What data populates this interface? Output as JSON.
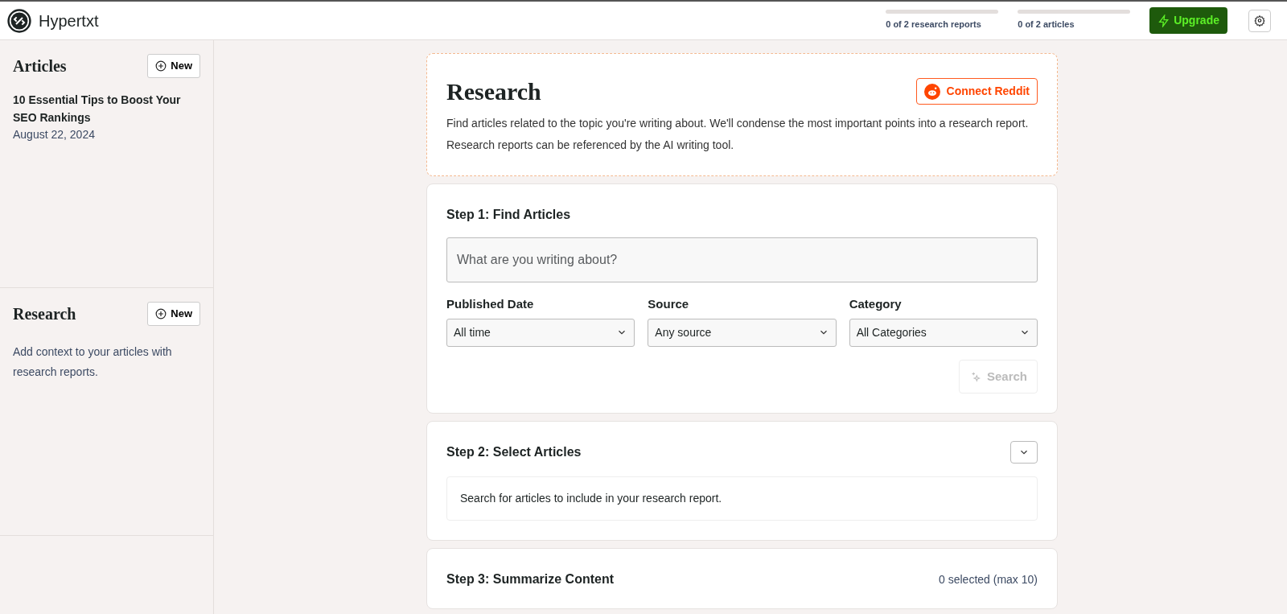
{
  "header": {
    "brand": "Hypertxt",
    "usage": [
      {
        "label": "0 of 2 research reports",
        "level": 0
      },
      {
        "label": "0 of 2 articles",
        "level": 0
      }
    ],
    "upgrade_button": "Upgrade"
  },
  "sidebar": {
    "sections": [
      {
        "title": "Articles",
        "new_button": "New",
        "items": [
          {
            "title": "10 Essential Tips to Boost Your SEO Rankings",
            "date": "August 22, 2024"
          }
        ]
      },
      {
        "title": "Research",
        "new_button": "New",
        "empty_text": "Add context to your articles with research reports."
      }
    ]
  },
  "intro": {
    "title": "Research",
    "connect_button": "Connect Reddit",
    "text": "Find articles related to the topic you're writing about. We'll condense the most important points into a research report. Research reports can be referenced by the AI writing tool."
  },
  "step1": {
    "title": "Step 1: Find Articles",
    "query": {
      "placeholder": "What are you writing about?"
    },
    "filters": [
      {
        "label": "Published Date",
        "value": "All time"
      },
      {
        "label": "Source",
        "value": "Any source"
      },
      {
        "label": "Category",
        "value": "All Categories"
      }
    ],
    "search_button": {
      "label": "Search",
      "disabled": true
    }
  },
  "step2": {
    "title": "Step 2: Select Articles",
    "empty_text": "Search for articles to include in your research report."
  },
  "step3": {
    "title": "Step 3: Summarize Content",
    "count": "0 selected (max 10)"
  }
}
